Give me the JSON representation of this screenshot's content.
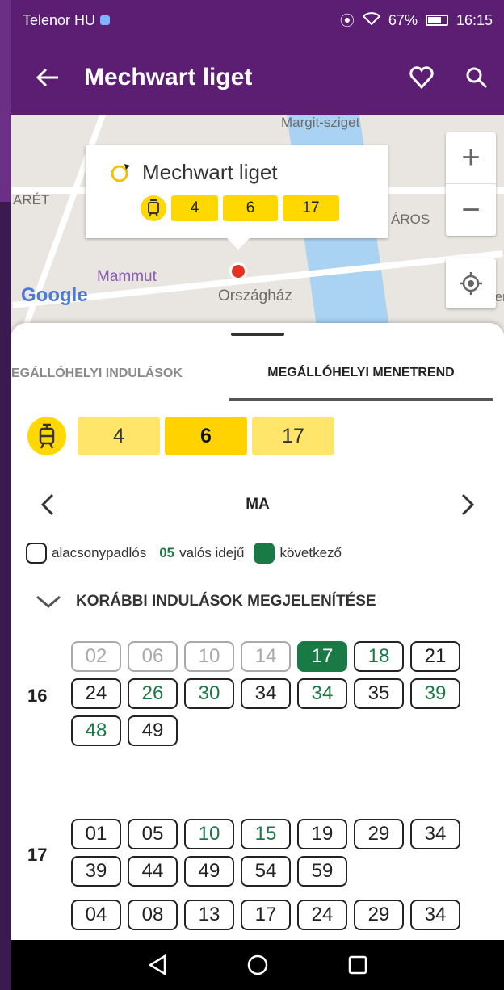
{
  "status": {
    "carrier": "Telenor HU",
    "signal": "67%",
    "time": "16:15"
  },
  "appbar": {
    "title": "Mechwart liget"
  },
  "map": {
    "labels": {
      "margit": "Margit-sziget",
      "aret": "ARÉT",
      "varos": "ÁROS",
      "mammut": "Mammut",
      "orszaghaz": "Országház",
      "ter": "Ter"
    },
    "google": "Google",
    "popup": {
      "name": "Mechwart liget",
      "routes": [
        "4",
        "6",
        "17"
      ]
    },
    "zoom_in": "+",
    "zoom_out": "−"
  },
  "tabs": {
    "departures": "EGÁLLÓHELYI INDULÁSOK",
    "timetable": "MEGÁLLÓHELYI MENETREND"
  },
  "routes": [
    {
      "label": "4",
      "selected": false
    },
    {
      "label": "6",
      "selected": true
    },
    {
      "label": "17",
      "selected": false
    }
  ],
  "day": "MA",
  "legend": {
    "low_floor": "alacsonypadlós",
    "sample": "05",
    "realtime": "valós idejű",
    "next": "következő"
  },
  "earlier": "KORÁBBI INDULÁSOK MEGJELENÍTÉSE",
  "colors": {
    "purple": "#5b1e72",
    "yellow": "#ffd800",
    "green": "#1a7a46"
  },
  "timetable": [
    {
      "hour": "16",
      "minutes": [
        {
          "m": "02",
          "state": "past"
        },
        {
          "m": "06",
          "state": "past"
        },
        {
          "m": "10",
          "state": "past"
        },
        {
          "m": "14",
          "state": "past"
        },
        {
          "m": "17",
          "state": "next"
        },
        {
          "m": "18",
          "state": "rt"
        },
        {
          "m": "21",
          "state": "normal"
        },
        {
          "m": "24",
          "state": "normal"
        },
        {
          "m": "26",
          "state": "rt"
        },
        {
          "m": "30",
          "state": "rt"
        },
        {
          "m": "34",
          "state": "normal"
        },
        {
          "m": "34",
          "state": "rt"
        },
        {
          "m": "35",
          "state": "normal"
        },
        {
          "m": "39",
          "state": "rt"
        },
        {
          "m": "48",
          "state": "rt"
        },
        {
          "m": "49",
          "state": "normal"
        }
      ]
    },
    {
      "hour": "17",
      "minutes": [
        {
          "m": "01",
          "state": "normal"
        },
        {
          "m": "05",
          "state": "normal"
        },
        {
          "m": "10",
          "state": "rt"
        },
        {
          "m": "15",
          "state": "rt"
        },
        {
          "m": "19",
          "state": "normal"
        },
        {
          "m": "29",
          "state": "normal"
        },
        {
          "m": "34",
          "state": "normal"
        },
        {
          "m": "39",
          "state": "normal"
        },
        {
          "m": "44",
          "state": "normal"
        },
        {
          "m": "49",
          "state": "normal"
        },
        {
          "m": "54",
          "state": "normal"
        },
        {
          "m": "59",
          "state": "normal"
        }
      ]
    },
    {
      "hour": "",
      "minutes": [
        {
          "m": "04",
          "state": "normal"
        },
        {
          "m": "08",
          "state": "normal"
        },
        {
          "m": "13",
          "state": "normal"
        },
        {
          "m": "17",
          "state": "normal"
        },
        {
          "m": "24",
          "state": "normal"
        },
        {
          "m": "29",
          "state": "normal"
        },
        {
          "m": "34",
          "state": "normal"
        }
      ]
    }
  ]
}
